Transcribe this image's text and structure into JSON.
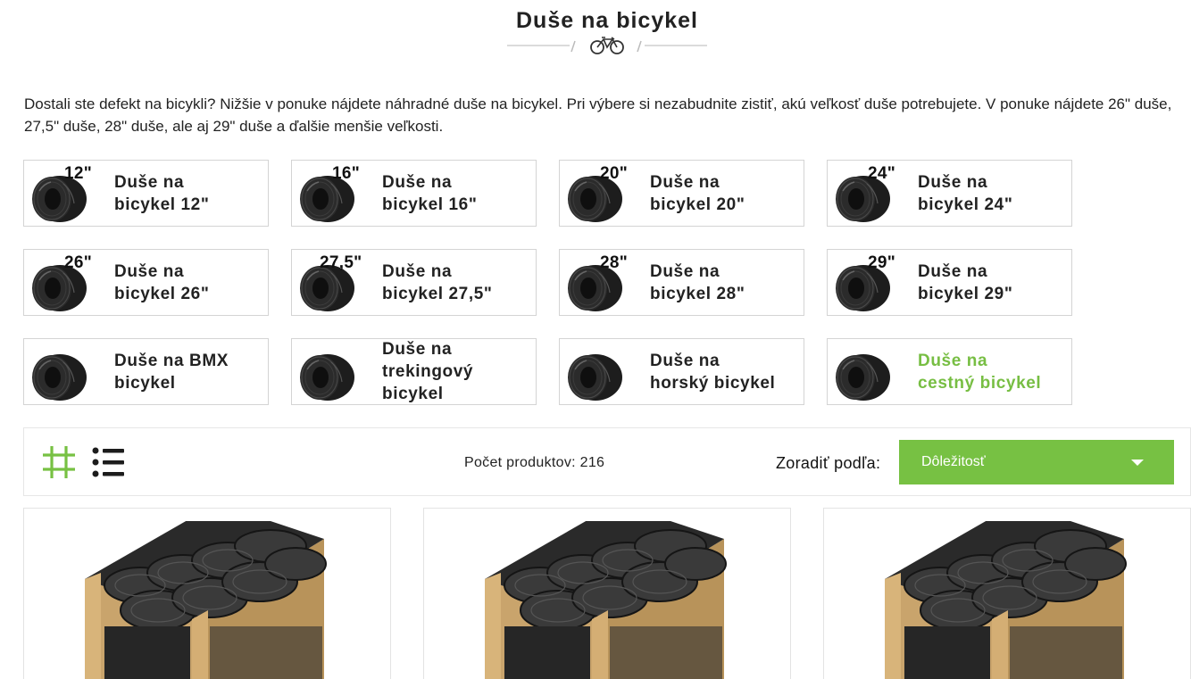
{
  "header": {
    "title": "Duše na bicykel",
    "icon": "bicycle-icon"
  },
  "intro": {
    "text": "Dostali ste defekt na bicykli? Nižšie v ponuke nájdete náhradné duše na bicykel. Pri výbere si nezabudnite zistiť, akú veľkosť duše potrebujete. V ponuke nájdete 26\" duše, 27,5\" duše, 28\" duše, ale aj 29\" duše a ďalšie menšie veľkosti."
  },
  "categories": [
    {
      "size": "12\"",
      "line1": "Duše na",
      "line2": "bicykel 12\""
    },
    {
      "size": "16\"",
      "line1": "Duše na",
      "line2": "bicykel 16\""
    },
    {
      "size": "20\"",
      "line1": "Duše na",
      "line2": "bicykel 20\""
    },
    {
      "size": "24\"",
      "line1": "Duše na",
      "line2": "bicykel 24\""
    },
    {
      "size": "26\"",
      "line1": "Duše na",
      "line2": "bicykel 26\""
    },
    {
      "size": "27,5\"",
      "line1": "Duše na",
      "line2": "bicykel 27,5\""
    },
    {
      "size": "28\"",
      "line1": "Duše na",
      "line2": "bicykel 28\""
    },
    {
      "size": "29\"",
      "line1": "Duše na",
      "line2": "bicykel 29\""
    },
    {
      "size": "",
      "line1": "Duše na BMX",
      "line2": "bicykel"
    },
    {
      "size": "",
      "line1": "Duše na",
      "line2": "trekingový",
      "line3": "bicykel"
    },
    {
      "size": "",
      "line1": "Duše na",
      "line2": "horský bicykel"
    },
    {
      "size": "",
      "line1": "Duše na",
      "line2": "cestný bicykel",
      "active": true
    }
  ],
  "toolbar": {
    "grid_icon": "grid-view-icon",
    "list_icon": "list-view-icon",
    "count_label": "Počet produktov:",
    "count_value": "216",
    "sort_label": "Zoradiť podľa:",
    "sort_selected": "Dôležitosť"
  },
  "colors": {
    "accent": "#77c143",
    "active_text": "#77be43",
    "border": "#d4d4d4"
  },
  "products": [
    {
      "image": "box-of-inner-tubes"
    },
    {
      "image": "box-of-inner-tubes"
    },
    {
      "image": "box-of-inner-tubes"
    }
  ]
}
